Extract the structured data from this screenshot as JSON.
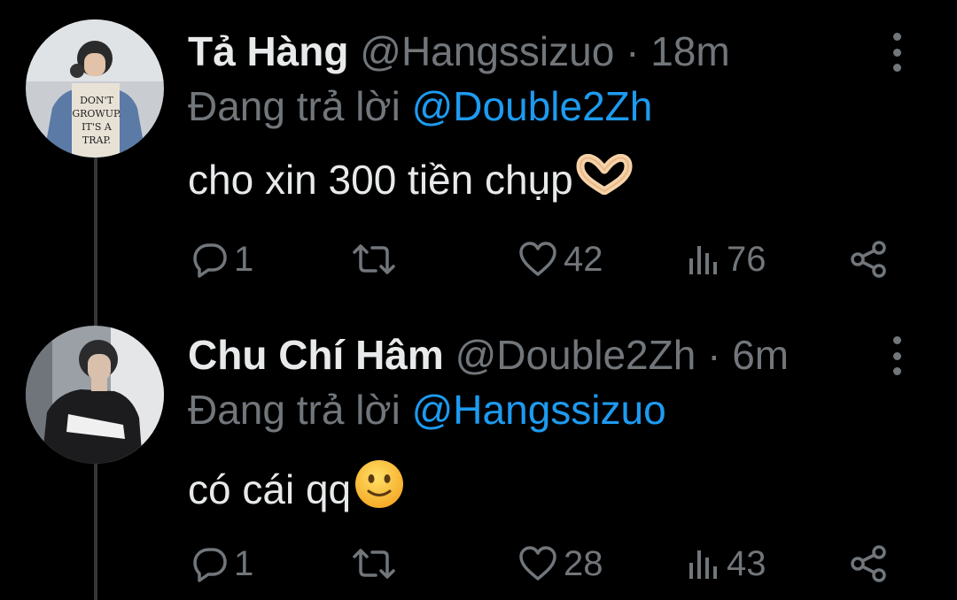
{
  "tweets": [
    {
      "display_name": "Tả Hàng",
      "handle": "@Hangssizuo",
      "separator": "·",
      "time": "18m",
      "replying_prefix": "Đang trả lời",
      "replying_to": "@Double2Zh",
      "text": "cho xin 300 tiền chụp",
      "emoji": "heart-hands",
      "stats": {
        "replies": "1",
        "retweets": "",
        "likes": "42",
        "views": "76"
      }
    },
    {
      "display_name": "Chu Chí Hâm",
      "handle": "@Double2Zh",
      "separator": "·",
      "time": "6m",
      "replying_prefix": "Đang trả lời",
      "replying_to": "@Hangssizuo",
      "text": "có cái qq",
      "emoji": "slightly-smiling-face",
      "stats": {
        "replies": "1",
        "retweets": "",
        "likes": "28",
        "views": "43"
      }
    }
  ],
  "colors": {
    "background": "#000000",
    "primary_text": "#e7e9ea",
    "secondary_text": "#71767b",
    "link": "#1d9bf0",
    "thread_line": "#333639"
  },
  "icons": [
    "reply-icon",
    "retweet-icon",
    "like-icon",
    "views-icon",
    "share-icon",
    "more-icon"
  ]
}
